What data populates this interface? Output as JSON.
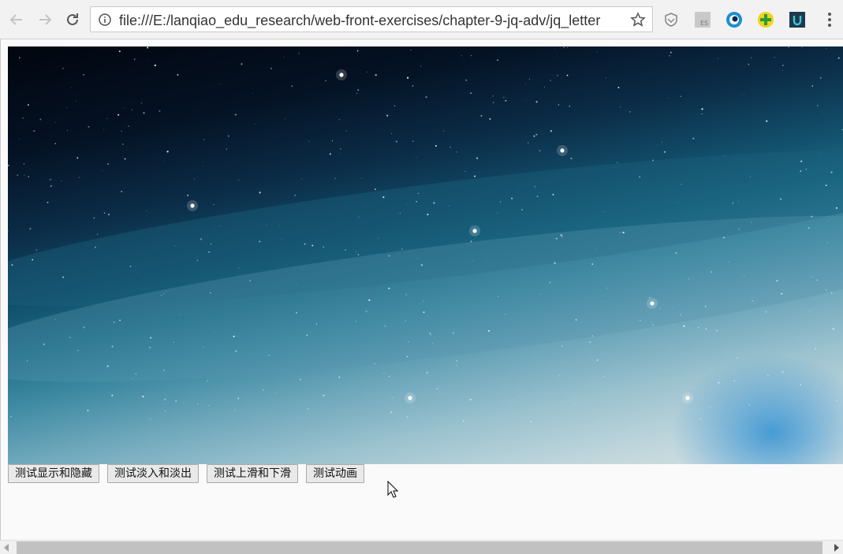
{
  "browser": {
    "url": "file:///E:/lanqiao_edu_research/web-front-exercises/chapter-9-jq-adv/jq_letter",
    "icons": {
      "back": "arrow-left-icon",
      "forward": "arrow-right-icon",
      "reload": "reload-icon",
      "info": "info-icon",
      "bookmark": "star-icon",
      "menu": "more-vert-icon"
    },
    "extensions": [
      {
        "name": "shield-extension-icon"
      },
      {
        "name": "es-extension-icon",
        "label": "ES"
      },
      {
        "name": "eye-extension-icon"
      },
      {
        "name": "plus-extension-icon"
      },
      {
        "name": "u-extension-icon",
        "label": "U"
      }
    ]
  },
  "page": {
    "image": {
      "description_icon": "starry-sky-image"
    },
    "buttons": {
      "show_hide": "测试显示和隐藏",
      "fade": "测试淡入和淡出",
      "slide": "测试上滑和下滑",
      "animate": "测试动画"
    }
  },
  "colors": {
    "sky_top": "#02060f",
    "sky_mid": "#12506c",
    "sky_bottom": "#d9e3e2",
    "button_bg": "#e9e9e9",
    "toolbar_bg": "#f2f2f2"
  }
}
